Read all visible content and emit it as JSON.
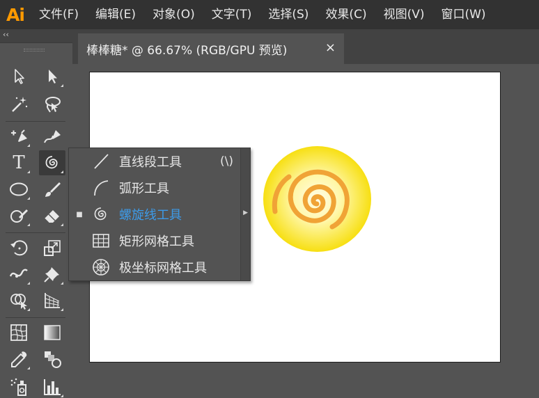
{
  "app": {
    "logo_text": "Ai",
    "accent_color": "#ff9a00",
    "menus": [
      "文件(F)",
      "编辑(E)",
      "对象(O)",
      "文字(T)",
      "选择(S)",
      "效果(C)",
      "视图(V)",
      "窗口(W)"
    ]
  },
  "document": {
    "tab_title": "棒棒糖* @ 66.67% (RGB/GPU 预览)",
    "close_glyph": "×"
  },
  "toolbar": {
    "collapse_glyph": "‹‹",
    "type_tool_glyph": "T"
  },
  "flyout": {
    "selected_marker": "■",
    "items": [
      {
        "label": "直线段工具",
        "shortcut": "(\\)",
        "icon": "line-segment-icon",
        "selected": false
      },
      {
        "label": "弧形工具",
        "shortcut": "",
        "icon": "arc-icon",
        "selected": false
      },
      {
        "label": "螺旋线工具",
        "shortcut": "",
        "icon": "spiral-icon",
        "selected": true
      },
      {
        "label": "矩形网格工具",
        "shortcut": "",
        "icon": "rectangular-grid-icon",
        "selected": false
      },
      {
        "label": "极坐标网格工具",
        "shortcut": "",
        "icon": "polar-grid-icon",
        "selected": false
      }
    ],
    "selected_color": "#3d9be9"
  },
  "artwork": {
    "circle_color_outer": "#f9e21c",
    "circle_color_inner": "#fffde8",
    "spiral_color": "#f0a336"
  }
}
